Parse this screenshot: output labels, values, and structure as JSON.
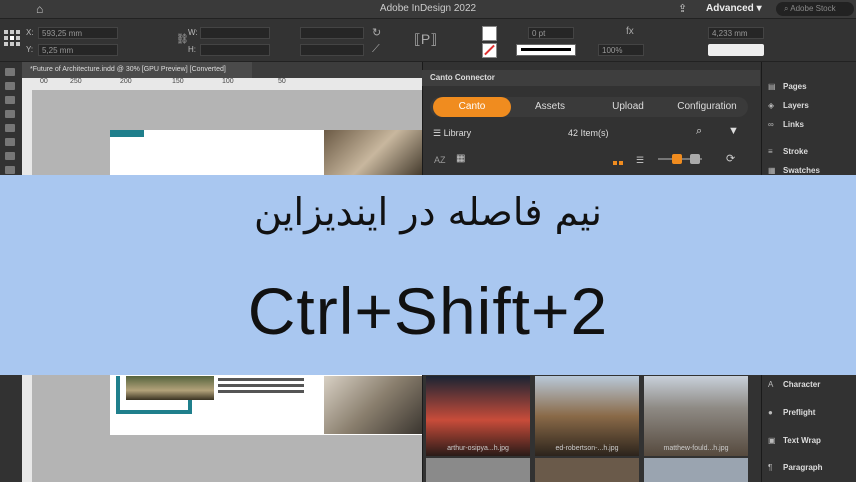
{
  "app": {
    "title": "Adobe InDesign 2022",
    "workspace": "Advanced",
    "stock_placeholder": "Adobe Stock"
  },
  "control": {
    "x_label": "X:",
    "y_label": "Y:",
    "x_value": "593,25 mm",
    "y_value": "5,25 mm",
    "w_label": "W:",
    "h_label": "H:",
    "stroke_weight": "0 pt",
    "opacity": "100%",
    "size_value": "4,233 mm"
  },
  "document": {
    "tab_label": "*Future of Architecture.indd @ 30% [GPU Preview] [Converted]",
    "ruler_ticks": [
      "00",
      "250",
      "200",
      "150",
      "100",
      "50"
    ]
  },
  "canto": {
    "panel_title": "Canto Connector",
    "tabs": [
      {
        "label": "Canto",
        "active": true
      },
      {
        "label": "Assets",
        "active": false
      },
      {
        "label": "Upload",
        "active": false
      },
      {
        "label": "Configuration",
        "active": false
      }
    ],
    "library_label": "Library",
    "item_count": "42 Item(s)",
    "sort_label": "AZ",
    "thumbnails": [
      {
        "caption": "arthur-osipya...h.jpg"
      },
      {
        "caption": "ed-robertson-...h.jpg"
      },
      {
        "caption": "matthew-fould...h.jpg"
      }
    ]
  },
  "panels": [
    {
      "label": "Pages",
      "icon": "pages-icon"
    },
    {
      "label": "Layers",
      "icon": "layers-icon"
    },
    {
      "label": "Links",
      "icon": "links-icon"
    },
    {
      "label": "Stroke",
      "icon": "stroke-icon"
    },
    {
      "label": "Swatches",
      "icon": "swatches-icon"
    },
    {
      "label": "Character",
      "icon": "character-icon"
    },
    {
      "label": "Preflight",
      "icon": "preflight-icon"
    },
    {
      "label": "Text Wrap",
      "icon": "text-wrap-icon"
    },
    {
      "label": "Paragraph",
      "icon": "paragraph-icon"
    }
  ],
  "banner": {
    "title_fa": "نیم فاصله در ایندیزاین",
    "shortcut": "Ctrl+Shift+2"
  },
  "colors": {
    "accent": "#f08c1f",
    "banner_bg": "#a9c7f0",
    "teal": "#1f7f8c"
  }
}
